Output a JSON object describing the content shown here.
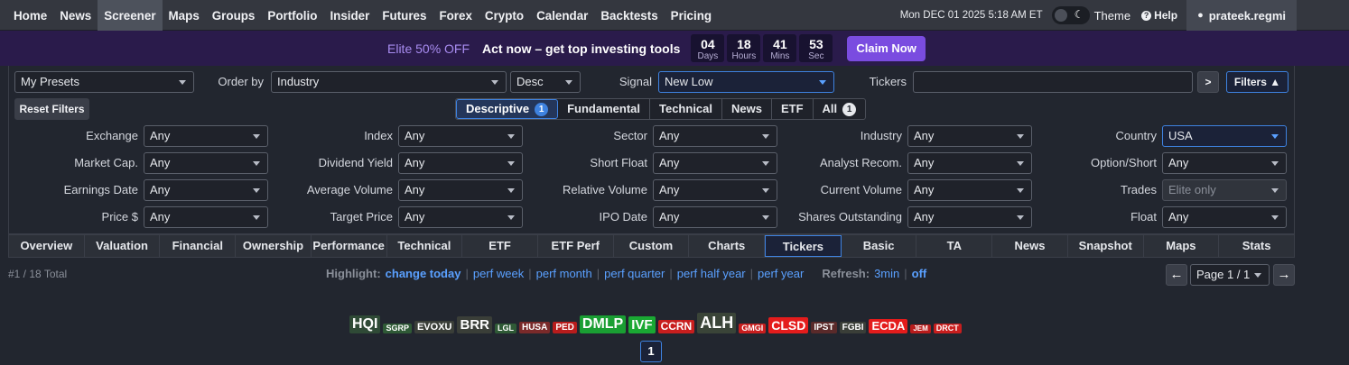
{
  "nav": {
    "items": [
      "Home",
      "News",
      "Screener",
      "Maps",
      "Groups",
      "Portfolio",
      "Insider",
      "Futures",
      "Forex",
      "Crypto",
      "Calendar",
      "Backtests",
      "Pricing"
    ],
    "active": "Screener",
    "datetime": "Mon DEC 01 2025 5:18 AM ET",
    "theme_label": "Theme",
    "help_label": "Help",
    "username": "prateek.regmi"
  },
  "promo": {
    "elite": "Elite 50% OFF",
    "act": "Act now – get top investing tools",
    "countdown": [
      {
        "value": "04",
        "unit": "Days"
      },
      {
        "value": "18",
        "unit": "Hours"
      },
      {
        "value": "41",
        "unit": "Mins"
      },
      {
        "value": "53",
        "unit": "Sec"
      }
    ],
    "claim": "Claim Now"
  },
  "controls": {
    "presets": "My Presets",
    "order_by_label": "Order by",
    "order_by": "Industry",
    "direction": "Desc",
    "signal_label": "Signal",
    "signal": "New Low",
    "tickers_label": "Tickers",
    "tickers_value": "",
    "arrow": ">",
    "filters": "Filters ▲",
    "reset": "Reset Filters"
  },
  "filter_tabs": [
    {
      "label": "Descriptive",
      "badge": "1",
      "active": true
    },
    {
      "label": "Fundamental"
    },
    {
      "label": "Technical"
    },
    {
      "label": "News"
    },
    {
      "label": "ETF"
    },
    {
      "label": "All",
      "badge": "1"
    }
  ],
  "filters": [
    [
      {
        "label": "Exchange",
        "value": "Any"
      },
      {
        "label": "Index",
        "value": "Any"
      },
      {
        "label": "Sector",
        "value": "Any"
      },
      {
        "label": "Industry",
        "value": "Any"
      },
      {
        "label": "Country",
        "value": "USA",
        "highlight": true
      }
    ],
    [
      {
        "label": "Market Cap.",
        "value": "Any"
      },
      {
        "label": "Dividend Yield",
        "value": "Any"
      },
      {
        "label": "Short Float",
        "value": "Any"
      },
      {
        "label": "Analyst Recom.",
        "value": "Any"
      },
      {
        "label": "Option/Short",
        "value": "Any"
      }
    ],
    [
      {
        "label": "Earnings Date",
        "value": "Any"
      },
      {
        "label": "Average Volume",
        "value": "Any"
      },
      {
        "label": "Relative Volume",
        "value": "Any"
      },
      {
        "label": "Current Volume",
        "value": "Any"
      },
      {
        "label": "Trades",
        "value": "Elite only",
        "disabled": true
      }
    ],
    [
      {
        "label": "Price $",
        "value": "Any"
      },
      {
        "label": "Target Price",
        "value": "Any"
      },
      {
        "label": "IPO Date",
        "value": "Any"
      },
      {
        "label": "Shares Outstanding",
        "value": "Any"
      },
      {
        "label": "Float",
        "value": "Any"
      }
    ]
  ],
  "view_tabs": [
    "Overview",
    "Valuation",
    "Financial",
    "Ownership",
    "Performance",
    "Technical",
    "ETF",
    "ETF Perf",
    "Custom",
    "Charts",
    "Tickers",
    "Basic",
    "TA",
    "News",
    "Snapshot",
    "Maps",
    "Stats"
  ],
  "active_view": "Tickers",
  "status": {
    "total": "#1 / 18 Total",
    "highlight_label": "Highlight:",
    "highlight_options": [
      "change today",
      "perf week",
      "perf month",
      "perf quarter",
      "perf half year",
      "perf year"
    ],
    "refresh_label": "Refresh:",
    "refresh_options": [
      "3min",
      "off"
    ],
    "page": "Page 1 / 1",
    "prev": "←",
    "next": "→"
  },
  "tickers": [
    {
      "symbol": "HQI",
      "color": "#2f4a36",
      "size": 16
    },
    {
      "symbol": "SGRP",
      "color": "#2f5a36",
      "size": 9
    },
    {
      "symbol": "EVOXU",
      "color": "#3a3e38",
      "size": 11
    },
    {
      "symbol": "BRR",
      "color": "#3a3e38",
      "size": 15
    },
    {
      "symbol": "LGL",
      "color": "#2f5a36",
      "size": 9
    },
    {
      "symbol": "HUSA",
      "color": "#7a2a2a",
      "size": 10
    },
    {
      "symbol": "PED",
      "color": "#b81c1c",
      "size": 10
    },
    {
      "symbol": "DMLP",
      "color": "#1a9e33",
      "size": 16
    },
    {
      "symbol": "IVF",
      "color": "#1aa833",
      "size": 15
    },
    {
      "symbol": "CCRN",
      "color": "#c81e1e",
      "size": 12
    },
    {
      "symbol": "ALH",
      "color": "#3a4438",
      "size": 18
    },
    {
      "symbol": "GMGI",
      "color": "#c81e1e",
      "size": 9
    },
    {
      "symbol": "CLSD",
      "color": "#e41c1c",
      "size": 14
    },
    {
      "symbol": "IPST",
      "color": "#5a2a2a",
      "size": 10
    },
    {
      "symbol": "FGBI",
      "color": "#3a3e38",
      "size": 10
    },
    {
      "symbol": "ECDA",
      "color": "#e41c1c",
      "size": 13
    },
    {
      "symbol": "JEM",
      "color": "#b81c1c",
      "size": 8
    },
    {
      "symbol": "DRCT",
      "color": "#c81e1e",
      "size": 9
    }
  ],
  "page_number": "1"
}
